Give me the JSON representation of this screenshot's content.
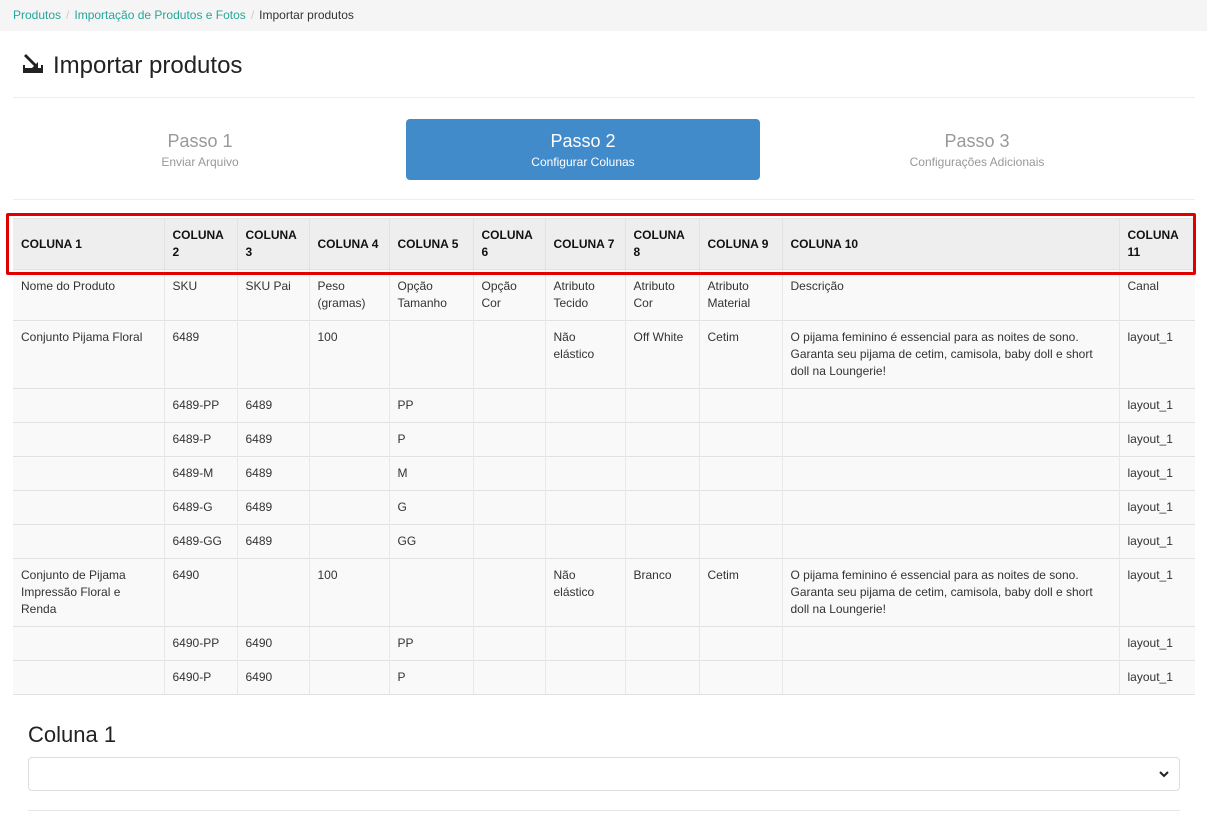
{
  "breadcrumb": {
    "items": [
      "Produtos",
      "Importação de Produtos e Fotos"
    ],
    "separator": "/",
    "current": "Importar produtos"
  },
  "page": {
    "title": "Importar produtos",
    "icon": "import-icon"
  },
  "steps": [
    {
      "title": "Passo 1",
      "subtitle": "Enviar Arquivo",
      "active": false
    },
    {
      "title": "Passo 2",
      "subtitle": "Configurar Colunas",
      "active": true
    },
    {
      "title": "Passo 3",
      "subtitle": "Configurações Adicionais",
      "active": false
    }
  ],
  "table": {
    "headers": [
      "COLUNA 1",
      "COLUNA 2",
      "COLUNA 3",
      "COLUNA 4",
      "COLUNA 5",
      "COLUNA 6",
      "COLUNA 7",
      "COLUNA 8",
      "COLUNA 9",
      "COLUNA 10",
      "COLUNA 11"
    ],
    "rows": [
      [
        "Nome do Produto",
        "SKU",
        "SKU Pai",
        "Peso (gramas)",
        "Opção Tamanho",
        "Opção Cor",
        "Atributo Tecido",
        "Atributo Cor",
        "Atributo Material",
        "Descrição",
        "Canal"
      ],
      [
        "Conjunto Pijama Floral",
        "6489",
        "",
        "100",
        "",
        "",
        "Não elástico",
        "Off White",
        "Cetim",
        "O pijama feminino é essencial para as noites de sono. Garanta seu pijama de cetim, camisola, baby doll e short doll na Loungerie!",
        "layout_1"
      ],
      [
        "",
        "6489-PP",
        "6489",
        "",
        "PP",
        "",
        "",
        "",
        "",
        "",
        "layout_1"
      ],
      [
        "",
        "6489-P",
        "6489",
        "",
        "P",
        "",
        "",
        "",
        "",
        "",
        "layout_1"
      ],
      [
        "",
        "6489-M",
        "6489",
        "",
        "M",
        "",
        "",
        "",
        "",
        "",
        "layout_1"
      ],
      [
        "",
        "6489-G",
        "6489",
        "",
        "G",
        "",
        "",
        "",
        "",
        "",
        "layout_1"
      ],
      [
        "",
        "6489-GG",
        "6489",
        "",
        "GG",
        "",
        "",
        "",
        "",
        "",
        "layout_1"
      ],
      [
        "Conjunto de Pijama Impressão Floral e Renda",
        "6490",
        "",
        "100",
        "",
        "",
        "Não elástico",
        "Branco",
        "Cetim",
        "O pijama feminino é essencial para as noites de sono. Garanta seu pijama de cetim, camisola, baby doll e short doll na Loungerie!",
        "layout_1"
      ],
      [
        "",
        "6490-PP",
        "6490",
        "",
        "PP",
        "",
        "",
        "",
        "",
        "",
        "layout_1"
      ],
      [
        "",
        "6490-P",
        "6490",
        "",
        "P",
        "",
        "",
        "",
        "",
        "",
        "layout_1"
      ]
    ]
  },
  "column_config": {
    "label": "Coluna 1",
    "select_value": ""
  },
  "colors": {
    "accent": "#428bca",
    "link": "#26a69a",
    "highlight": "#e00000"
  }
}
